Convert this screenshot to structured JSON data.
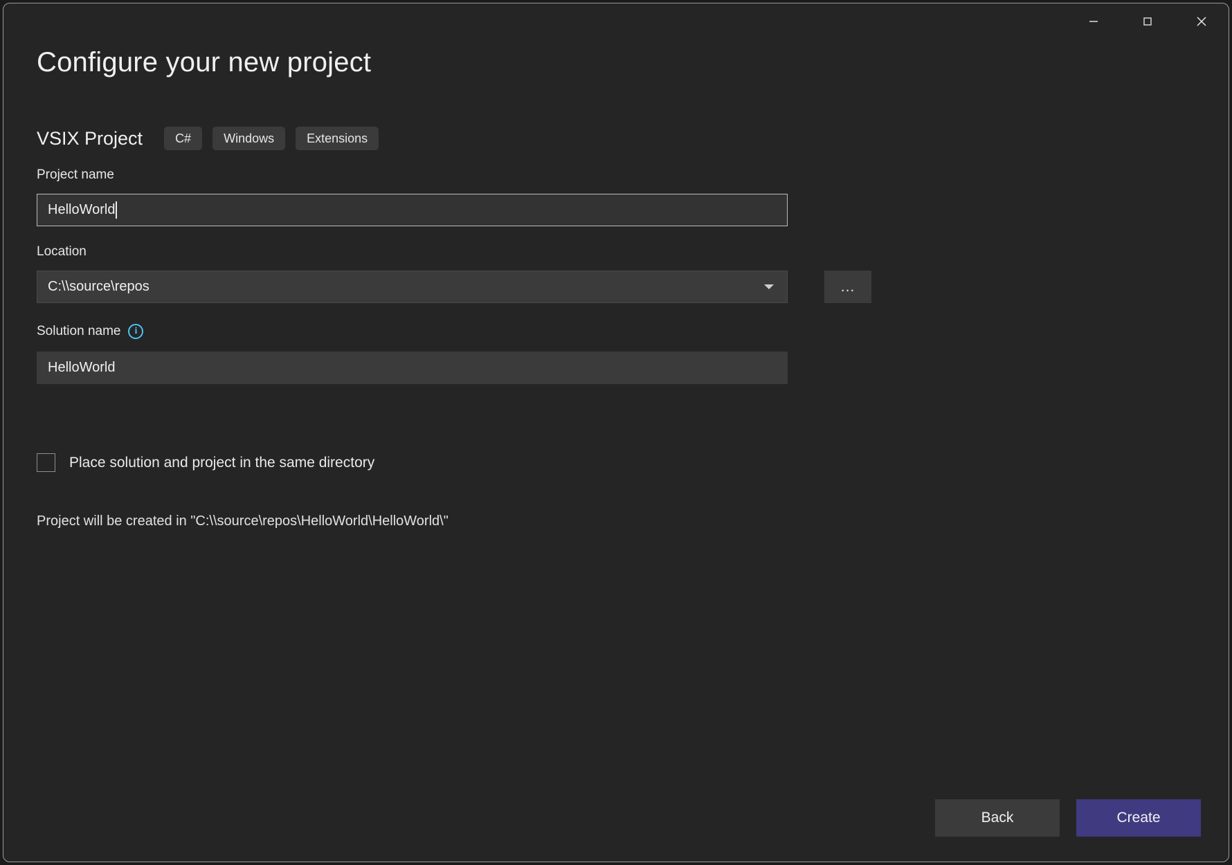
{
  "window": {
    "controls": [
      {
        "name": "minimize",
        "label": "Minimize"
      },
      {
        "name": "maximize",
        "label": "Maximize"
      },
      {
        "name": "close",
        "label": "Close"
      }
    ]
  },
  "header": {
    "title": "Configure your new project",
    "template_name": "VSIX Project",
    "tags": [
      "C#",
      "Windows",
      "Extensions"
    ]
  },
  "form": {
    "project_name": {
      "label": "Project name",
      "value": "HelloWorld",
      "focused": true
    },
    "location": {
      "label": "Location",
      "value": "C:\\\\source\\repos",
      "browse_label": "..."
    },
    "solution_name": {
      "label": "Solution name",
      "info_glyph": "i",
      "value": "HelloWorld"
    },
    "same_directory": {
      "label": "Place solution and project in the same directory",
      "checked": false
    },
    "status": "Project will be created in \"C:\\\\source\\repos\\HelloWorld\\HelloWorld\\\""
  },
  "footer": {
    "back_label": "Back",
    "create_label": "Create"
  },
  "colors": {
    "dialog_bg": "#252526",
    "field_bg": "#3b3b3c",
    "accent_primary": "#403a80",
    "info_blue": "#4dc3f0",
    "text": "#f0f0f0"
  }
}
